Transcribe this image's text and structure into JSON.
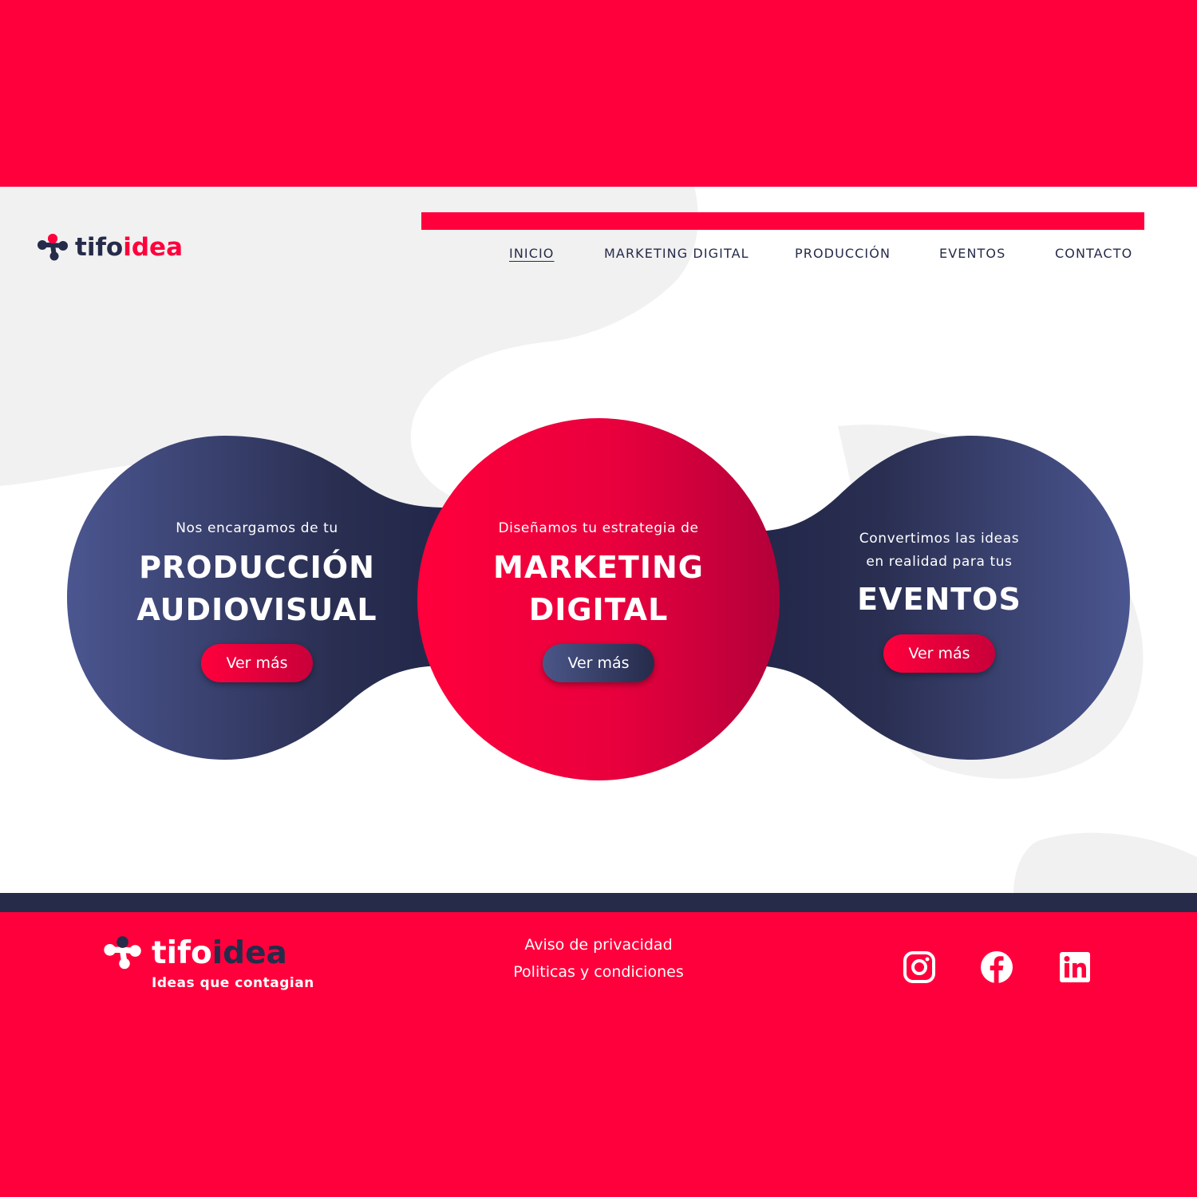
{
  "brand": {
    "logo_part1": "tifo",
    "logo_part2": "idea",
    "tagline": "Ideas que contagian"
  },
  "nav": {
    "items": [
      {
        "label": "INICIO",
        "active": true
      },
      {
        "label": "MARKETING DIGITAL",
        "active": false
      },
      {
        "label": "PRODUCCIÓN",
        "active": false
      },
      {
        "label": "EVENTOS",
        "active": false
      },
      {
        "label": "CONTACTO",
        "active": false
      }
    ]
  },
  "hero": {
    "left": {
      "intro": "Nos encargamos de tu",
      "title_line1": "PRODUCCIÓN",
      "title_line2": "AUDIOVISUAL",
      "button": "Ver más"
    },
    "center": {
      "intro": "Diseñamos tu estrategia de",
      "title_line1": "MARKETING",
      "title_line2": "DIGITAL",
      "button": "Ver más"
    },
    "right": {
      "intro_line1": "Convertimos las ideas",
      "intro_line2": "en realidad para tus",
      "title": "EVENTOS",
      "button": "Ver más"
    }
  },
  "footer": {
    "links": [
      "Aviso de privacidad",
      "Politicas y condiciones"
    ],
    "social": [
      "instagram-icon",
      "facebook-icon",
      "linkedin-icon"
    ]
  },
  "colors": {
    "brand_red": "#ff003c",
    "navy": "#262b4a",
    "navy_light": "#4b5688",
    "background_blob": "#f1f1f1"
  }
}
